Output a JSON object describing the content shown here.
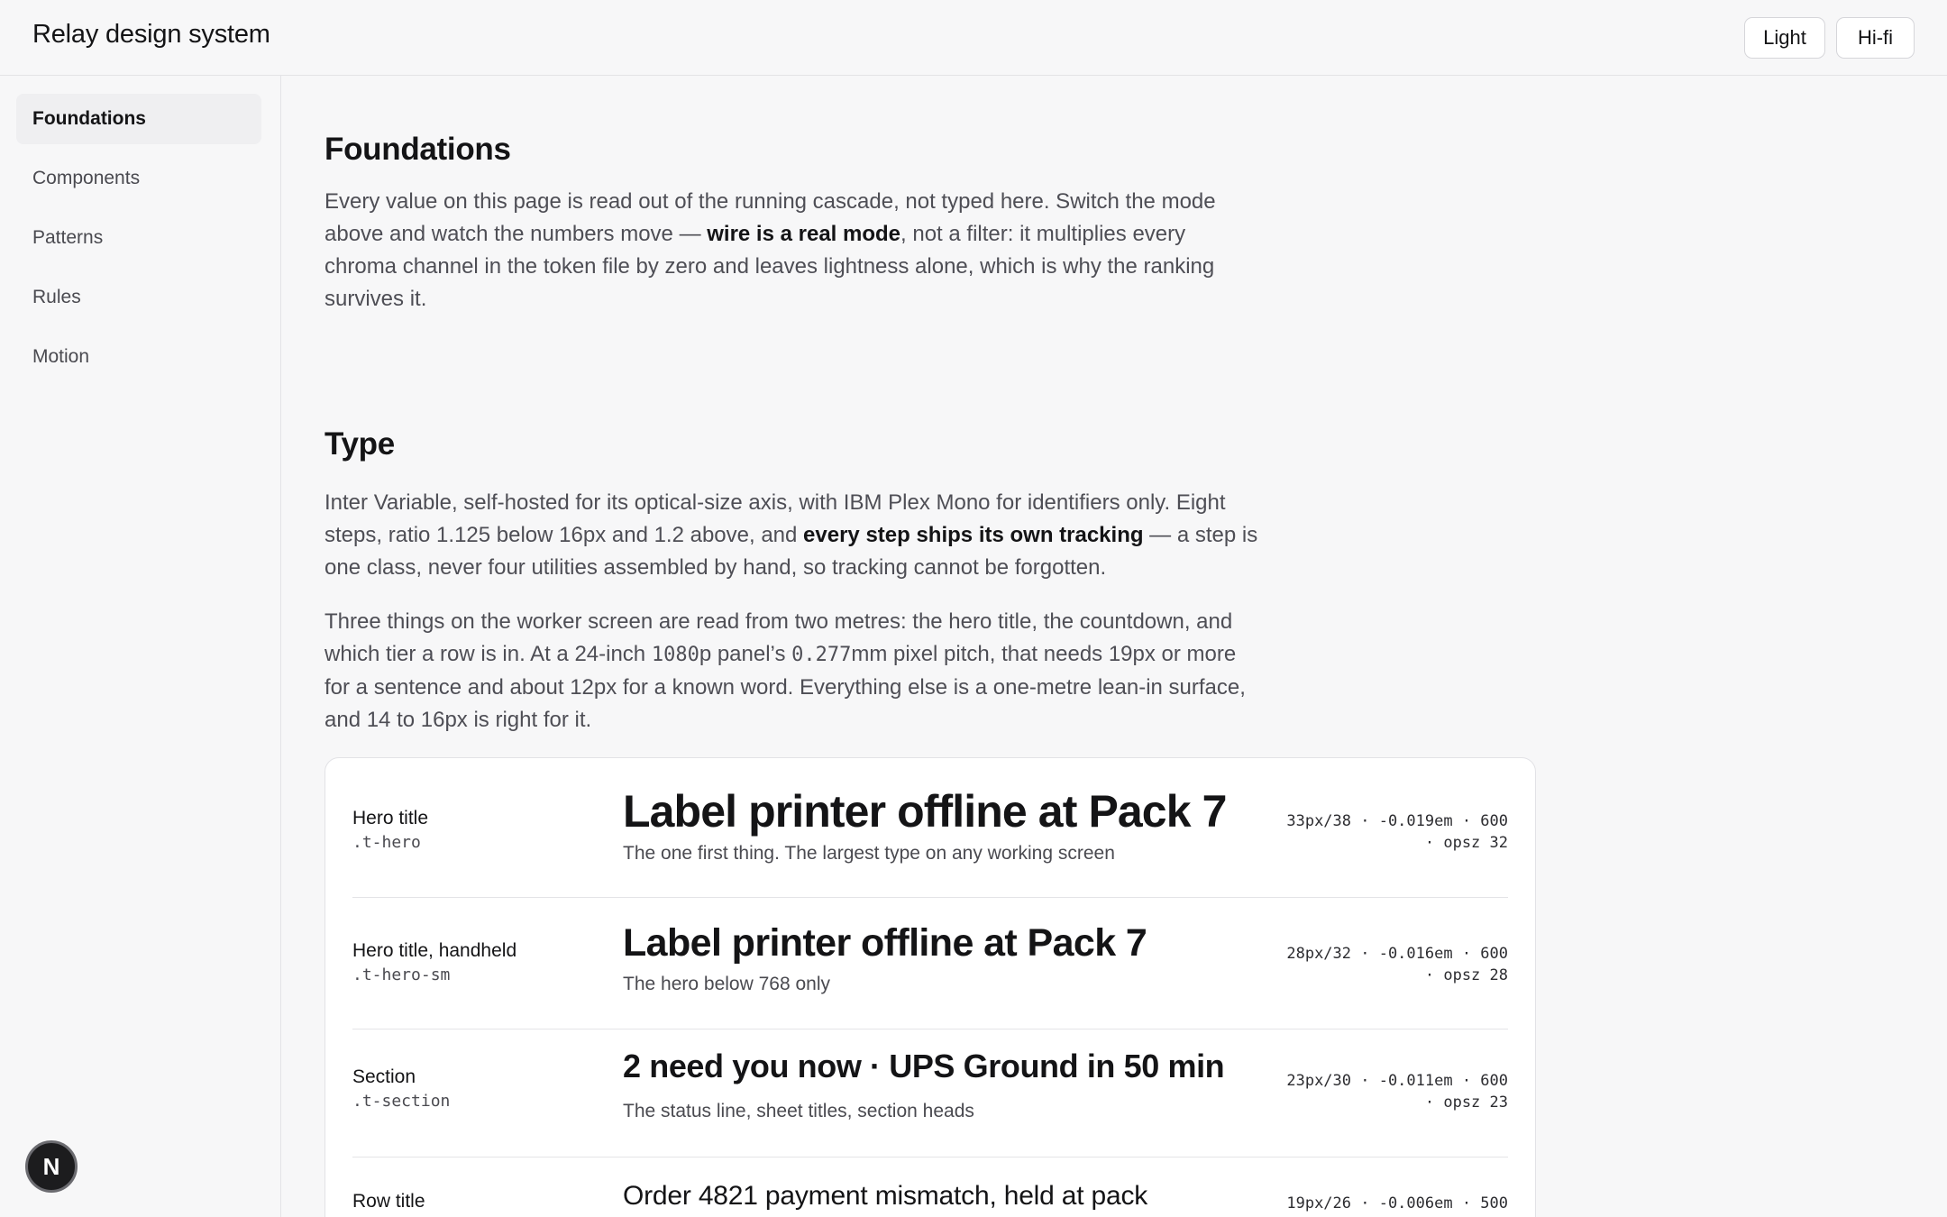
{
  "header": {
    "title": "Relay design system",
    "modes": [
      "Light",
      "Hi-fi"
    ]
  },
  "sidebar": {
    "items": [
      {
        "label": "Foundations",
        "active": true
      },
      {
        "label": "Components",
        "active": false
      },
      {
        "label": "Patterns",
        "active": false
      },
      {
        "label": "Rules",
        "active": false
      },
      {
        "label": "Motion",
        "active": false
      }
    ]
  },
  "fab": {
    "label": "N"
  },
  "foundations": {
    "title": "Foundations",
    "para_1a": "Every value on this page is read out of the running cascade, not typed here. Switch the mode above and watch the numbers move — ",
    "para_1b": "wire is a real mode",
    "para_1c": ", not a filter: it multiplies every chroma channel in the token file by zero and leaves lightness alone, which is why the ranking survives it."
  },
  "type": {
    "title": "Type",
    "para_1a": "Inter Variable, self-hosted for its optical-size axis, with IBM Plex Mono for identifiers only. Eight steps, ratio 1.125 below 16px and 1.2 above, and ",
    "para_1b": "every step ships its own tracking",
    "para_1c": " — a step is one class, never four utilities assembled by hand, so tracking cannot be forgotten.",
    "para_2a": "Three things on the worker screen are read from two metres: the hero title, the countdown, and which tier a row is in. At a 24-inch ",
    "para_2b": "1080",
    "para_2c": "p panel’s ",
    "para_2d": "0.277",
    "para_2e": "mm pixel pitch, that needs 19px or more for a sentence and about 12px for a known word. Everything else is a one-metre lean-in surface, and 14 to 16px is right for it.",
    "rows": [
      {
        "name": "Hero title",
        "cls": ".t-hero",
        "sample": "Label printer offline at Pack 7",
        "note": "The one first thing. The largest type on any working screen",
        "spec_1": "33px/38 · -0.019em · 600",
        "spec_2": "· opsz 32"
      },
      {
        "name": "Hero title, handheld",
        "cls": ".t-hero-sm",
        "sample": "Label printer offline at Pack 7",
        "note": "The hero below 768 only",
        "spec_1": "28px/32 · -0.016em · 600",
        "spec_2": "· opsz 28"
      },
      {
        "name": "Section",
        "cls": ".t-section",
        "sample": "2 need you now · UPS Ground in 50 min",
        "note": "The status line, sheet titles, section heads",
        "spec_1": "23px/30 · -0.011em · 600",
        "spec_2": "· opsz 23"
      },
      {
        "name": "Row title",
        "cls": ".t-row",
        "sample": "Order 4821 payment mismatch, held at pack",
        "note": "",
        "spec_1": "19px/26 · -0.006em · 500",
        "spec_2": ""
      }
    ]
  }
}
